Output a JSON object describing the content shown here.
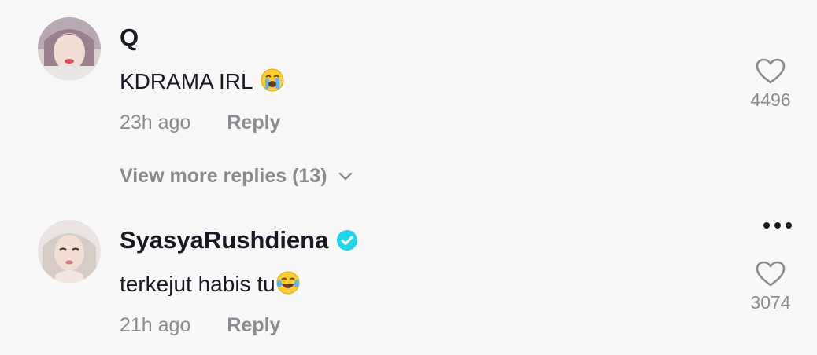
{
  "comments": [
    {
      "username": "Q",
      "text": "KDRAMA IRL",
      "emoji": "loudly-crying-face-emoji",
      "time": "23h ago",
      "reply_label": "Reply",
      "likes": "4496",
      "verified": false
    },
    {
      "username": "SyasyaRushdiena",
      "text": "terkejut habis tu",
      "emoji": "tears-of-joy-emoji",
      "time": "21h ago",
      "reply_label": "Reply",
      "likes": "3074",
      "verified": true
    }
  ],
  "view_more": "View more replies (13)",
  "colors": {
    "background": "#f8f8f8",
    "primary_text": "#161823",
    "secondary_text": "#8a8b91",
    "verified": "#20d5ec"
  }
}
